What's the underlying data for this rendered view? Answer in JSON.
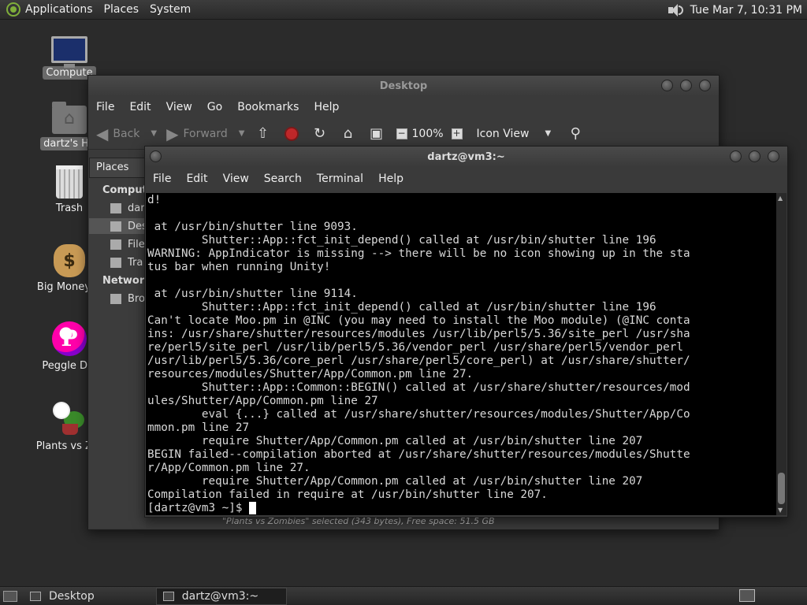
{
  "top_panel": {
    "menus": [
      "Applications",
      "Places",
      "System"
    ],
    "clock": "Tue Mar  7, 10:31 PM"
  },
  "desktop_icons": [
    {
      "label": "Compute",
      "icon": "computer-icon"
    },
    {
      "label": "dartz's Ho",
      "icon": "home-folder-icon"
    },
    {
      "label": "Trash",
      "icon": "trash-icon"
    },
    {
      "label": "Big Money D",
      "icon": "money-bag-icon"
    },
    {
      "label": "Peggle Del",
      "icon": "peggle-icon"
    },
    {
      "label": "Plants vs Zor",
      "icon": "plants-icon"
    }
  ],
  "file_manager": {
    "title": "Desktop",
    "menus": [
      "File",
      "Edit",
      "View",
      "Go",
      "Bookmarks",
      "Help"
    ],
    "toolbar": {
      "back": "Back",
      "forward": "Forward",
      "zoom": "100%",
      "view_mode": "Icon View"
    },
    "sidebar": {
      "header": "Places",
      "computer_header": "Compute",
      "items": [
        "dar",
        "Des",
        "File",
        "Tra"
      ],
      "network_header": "Network",
      "network_items": [
        "Bro"
      ]
    },
    "status": "\"Plants vs Zombies\" selected (343 bytes), Free space: 51.5 GB"
  },
  "terminal": {
    "title": "dartz@vm3:~",
    "menus": [
      "File",
      "Edit",
      "View",
      "Search",
      "Terminal",
      "Help"
    ],
    "lines": [
      "d!",
      "",
      " at /usr/bin/shutter line 9093.",
      "        Shutter::App::fct_init_depend() called at /usr/bin/shutter line 196",
      "WARNING: AppIndicator is missing --> there will be no icon showing up in the sta",
      "tus bar when running Unity!",
      "",
      " at /usr/bin/shutter line 9114.",
      "        Shutter::App::fct_init_depend() called at /usr/bin/shutter line 196",
      "Can't locate Moo.pm in @INC (you may need to install the Moo module) (@INC conta",
      "ins: /usr/share/shutter/resources/modules /usr/lib/perl5/5.36/site_perl /usr/sha",
      "re/perl5/site_perl /usr/lib/perl5/5.36/vendor_perl /usr/share/perl5/vendor_perl",
      "/usr/lib/perl5/5.36/core_perl /usr/share/perl5/core_perl) at /usr/share/shutter/",
      "resources/modules/Shutter/App/Common.pm line 27.",
      "        Shutter::App::Common::BEGIN() called at /usr/share/shutter/resources/mod",
      "ules/Shutter/App/Common.pm line 27",
      "        eval {...} called at /usr/share/shutter/resources/modules/Shutter/App/Co",
      "mmon.pm line 27",
      "        require Shutter/App/Common.pm called at /usr/bin/shutter line 207",
      "BEGIN failed--compilation aborted at /usr/share/shutter/resources/modules/Shutte",
      "r/App/Common.pm line 27.",
      "        require Shutter/App/Common.pm called at /usr/bin/shutter line 207",
      "Compilation failed in require at /usr/bin/shutter line 207."
    ],
    "prompt": "[dartz@vm3 ~]$ "
  },
  "taskbar": {
    "tasks": [
      "Desktop",
      "dartz@vm3:~"
    ]
  }
}
